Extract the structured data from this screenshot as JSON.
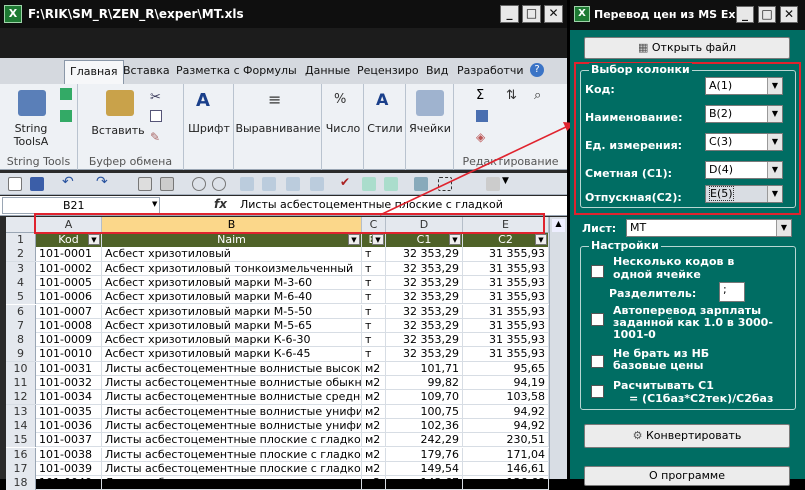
{
  "excel": {
    "title": "F:\\RIK\\SM_R\\ZEN_R\\exper\\MT.xls",
    "app_icon": "X",
    "ribbon_tabs": [
      "Главная",
      "Вставка",
      "Разметка с",
      "Формулы",
      "Данные",
      "Рецензиро",
      "Вид",
      "Разработчи"
    ],
    "groups": {
      "string_tools": {
        "btn": "String\nToolsA",
        "caption": "String Tools"
      },
      "clipboard": {
        "paste": "Вставить",
        "caption": "Буфер обмена"
      },
      "font": "Шрифт",
      "align": "Выравнивание",
      "number": "Число",
      "styles": "Стили",
      "cells": "Ячейки",
      "edit_caption": "Редактирование"
    },
    "name_box": "B21",
    "fx": "fx",
    "formula": "Листы асбестоцементные плоские с гладкой",
    "col_headers": [
      "A",
      "B",
      "C",
      "D",
      "E"
    ],
    "rows": [
      {
        "n": "1",
        "a": "Kod",
        "b": "Naim",
        "c": "Ei",
        "d": "C1",
        "e": "C2"
      },
      {
        "n": "2",
        "a": "101-0001",
        "b": "Асбест хризотиловый",
        "c": "т",
        "d": "32 353,29",
        "e": "31 355,93"
      },
      {
        "n": "3",
        "a": "101-0002",
        "b": "Асбест хризотиловый тонкоизмельченный",
        "c": "т",
        "d": "32 353,29",
        "e": "31 355,93"
      },
      {
        "n": "4",
        "a": "101-0005",
        "b": "Асбест хризотиловый марки М-3-60",
        "c": "т",
        "d": "32 353,29",
        "e": "31 355,93"
      },
      {
        "n": "5",
        "a": "101-0006",
        "b": "Асбест хризотиловый марки М-6-40",
        "c": "т",
        "d": "32 353,29",
        "e": "31 355,93"
      },
      {
        "n": "6",
        "a": "101-0007",
        "b": "Асбест хризотиловый марки М-5-50",
        "c": "т",
        "d": "32 353,29",
        "e": "31 355,93"
      },
      {
        "n": "7",
        "a": "101-0008",
        "b": "Асбест хризотиловый марки М-5-65",
        "c": "т",
        "d": "32 353,29",
        "e": "31 355,93"
      },
      {
        "n": "8",
        "a": "101-0009",
        "b": "Асбест хризотиловый марки К-6-30",
        "c": "т",
        "d": "32 353,29",
        "e": "31 355,93"
      },
      {
        "n": "9",
        "a": "101-0010",
        "b": "Асбест хризотиловый марки К-6-45",
        "c": "т",
        "d": "32 353,29",
        "e": "31 355,93"
      },
      {
        "n": "10",
        "a": "101-0031",
        "b": "Листы асбестоцементные волнистые высоко",
        "c": "м2",
        "d": "101,71",
        "e": "95,65"
      },
      {
        "n": "11",
        "a": "101-0032",
        "b": "Листы асбестоцементные волнистые обыкн",
        "c": "м2",
        "d": "99,82",
        "e": "94,19"
      },
      {
        "n": "12",
        "a": "101-0034",
        "b": "Листы асбестоцементные волнистые средне",
        "c": "м2",
        "d": "109,70",
        "e": "103,58"
      },
      {
        "n": "13",
        "a": "101-0035",
        "b": "Листы асбестоцементные волнистые унифи",
        "c": "м2",
        "d": "100,75",
        "e": "94,92"
      },
      {
        "n": "14",
        "a": "101-0036",
        "b": "Листы асбестоцементные волнистые унифи",
        "c": "м2",
        "d": "102,36",
        "e": "94,92"
      },
      {
        "n": "15",
        "a": "101-0037",
        "b": "Листы асбестоцементные плоские с гладкой",
        "c": "м2",
        "d": "242,29",
        "e": "230,51"
      },
      {
        "n": "16",
        "a": "101-0038",
        "b": "Листы асбестоцементные плоские с гладкой",
        "c": "м2",
        "d": "179,76",
        "e": "171,04"
      },
      {
        "n": "17",
        "a": "101-0039",
        "b": "Листы асбестоцементные плоские с гладкой",
        "c": "м2",
        "d": "149,54",
        "e": "146,61"
      },
      {
        "n": "18",
        "a": "101-0040",
        "b": "Листы асбестоцементные плоские с гладкой",
        "c": "м2",
        "d": "143,67",
        "e": "136,68"
      }
    ]
  },
  "panel": {
    "title": "Перевод цен из MS Ex...",
    "open_btn": "Открыть файл",
    "col_group": "Выбор колонки",
    "fields": [
      {
        "label": "Код:",
        "value": "A(1)"
      },
      {
        "label": "Наименование:",
        "value": "B(2)"
      },
      {
        "label": "Ед. измерения:",
        "value": "C(3)"
      },
      {
        "label": "Сметная (С1):",
        "value": "D(4)"
      },
      {
        "label": "Отпускная(С2):",
        "value": "E(5)"
      }
    ],
    "sheet_label": "Лист:",
    "sheet_value": "MT",
    "settings_group": "Настройки",
    "opt1": "Несколько кодов в одной ячейке",
    "separator_label": "Разделитель:",
    "separator_value": ";",
    "opt2": "Автоперевод зарплаты заданной как 1.0 в 3000-1001-0",
    "opt3": "Не брать из НБ базовые цены",
    "opt4a": "Расчитывать С1",
    "opt4b": "= (С1баз*С2тек)/С2баз",
    "convert_btn": "Конвертировать",
    "about_btn": "О программе"
  },
  "colors": {
    "accent_red": "#e0232e",
    "panel_bg": "#006d63",
    "header_green": "#4f6228"
  }
}
